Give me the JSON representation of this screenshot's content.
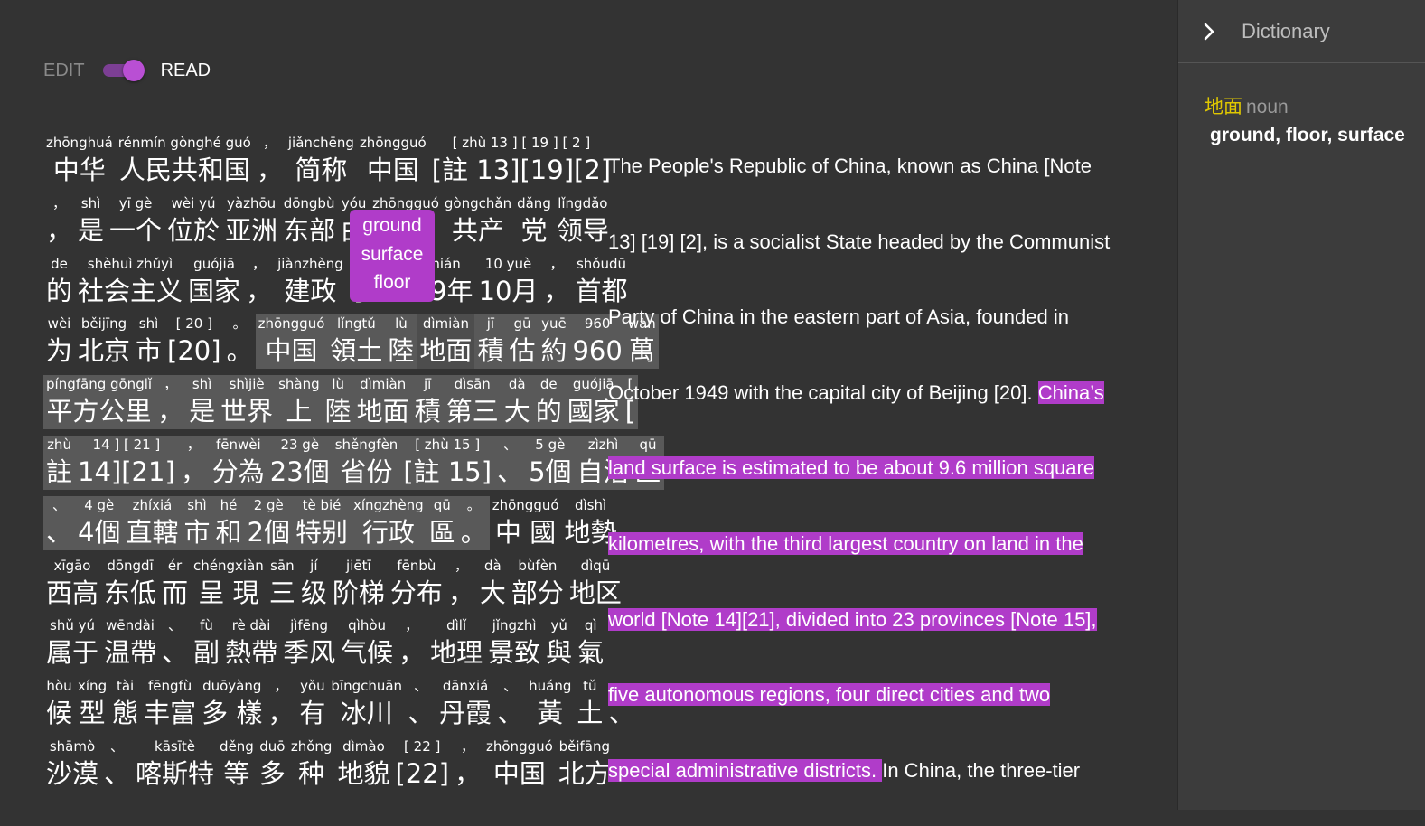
{
  "mode_toggle": {
    "edit_label": "EDIT",
    "read_label": "READ",
    "selected": "READ"
  },
  "chinese_lines": [
    [
      {
        "py": "zhōnghuá",
        "hz": "中华"
      },
      {
        "py": "rénmín gònghé guó",
        "hz": "人民共和国"
      },
      {
        "py": "，",
        "hz": "，"
      },
      {
        "py": "jiǎnchēng",
        "hz": "简称"
      },
      {
        "py": "zhōngguó",
        "hz": "中国"
      },
      {
        "py": "[ zhù 13 ] [ 19 ] [ 2 ]",
        "hz": "[註 13][19][2]"
      }
    ],
    [
      {
        "py": "，",
        "hz": "，"
      },
      {
        "py": "shì",
        "hz": "是"
      },
      {
        "py": "yī gè",
        "hz": "一个"
      },
      {
        "py": "wèi yú",
        "hz": "位於"
      },
      {
        "py": "yàzhōu",
        "hz": "亚洲"
      },
      {
        "py": "dōngbù",
        "hz": "东部"
      },
      {
        "py": "yóu",
        "hz": "由"
      },
      {
        "py": "zhōngguó",
        "hz": "中国"
      },
      {
        "py": "gòngchǎn",
        "hz": "共产"
      },
      {
        "py": "dǎng",
        "hz": "党"
      },
      {
        "py": "lǐngdǎo",
        "hz": "领导"
      }
    ],
    [
      {
        "py": "de",
        "hz": "的"
      },
      {
        "py": "shèhuì zhǔyì",
        "hz": "社会主义"
      },
      {
        "py": "guójiā",
        "hz": "国家"
      },
      {
        "py": "，",
        "hz": "，"
      },
      {
        "py": "jiànzhèng",
        "hz": "建政"
      },
      {
        "py": "yú",
        "hz": "于"
      },
      {
        "py": "1949 nián",
        "hz": "1949年"
      },
      {
        "py": "10 yuè",
        "hz": "10月"
      },
      {
        "py": "，",
        "hz": "，"
      },
      {
        "py": "shǒudū",
        "hz": "首都"
      }
    ],
    [
      {
        "py": "wèi",
        "hz": "为"
      },
      {
        "py": "běijīng",
        "hz": "北京"
      },
      {
        "py": "shì",
        "hz": "市"
      },
      {
        "py": "[ 20 ]",
        "hz": "[20]"
      },
      {
        "py": "。",
        "hz": "。"
      },
      {
        "py": "zhōngguó",
        "hz": "中国",
        "hl": true
      },
      {
        "py": "lǐngtǔ",
        "hz": "領土",
        "hl": true
      },
      {
        "py": "lù",
        "hz": "陸",
        "hl": true
      },
      {
        "py": "dìmiàn",
        "hz": "地面",
        "hl": true,
        "active": true
      },
      {
        "py": "jī",
        "hz": "積",
        "hl": true
      },
      {
        "py": "gū",
        "hz": "估",
        "hl": true
      },
      {
        "py": "yuē",
        "hz": "約",
        "hl": true
      },
      {
        "py": "960",
        "hz": "960",
        "hl": true
      },
      {
        "py": "wàn",
        "hz": "萬",
        "hl": true
      }
    ],
    [
      {
        "py": "píngfāng gōnglǐ",
        "hz": "平方公里",
        "hl": true
      },
      {
        "py": "，",
        "hz": "，",
        "hl": true
      },
      {
        "py": "shì",
        "hz": "是",
        "hl": true
      },
      {
        "py": "shìjiè",
        "hz": "世界",
        "hl": true
      },
      {
        "py": "shàng",
        "hz": "上",
        "hl": true
      },
      {
        "py": "lù",
        "hz": "陸",
        "hl": true
      },
      {
        "py": "dìmiàn",
        "hz": "地面",
        "hl": true
      },
      {
        "py": "jī",
        "hz": "積",
        "hl": true
      },
      {
        "py": "dìsān",
        "hz": "第三",
        "hl": true
      },
      {
        "py": "dà",
        "hz": "大",
        "hl": true
      },
      {
        "py": "de",
        "hz": "的",
        "hl": true
      },
      {
        "py": "guójiā",
        "hz": "國家",
        "hl": true
      },
      {
        "py": "[",
        "hz": "[",
        "hl": true
      }
    ],
    [
      {
        "py": "zhù",
        "hz": "註",
        "hl": true
      },
      {
        "py": "14 ] [ 21 ]",
        "hz": "14][21]",
        "hl": true
      },
      {
        "py": "，",
        "hz": "，",
        "hl": true
      },
      {
        "py": "fēnwèi",
        "hz": "分為",
        "hl": true
      },
      {
        "py": "23 gè",
        "hz": "23個",
        "hl": true
      },
      {
        "py": "shěngfèn",
        "hz": "省份",
        "hl": true
      },
      {
        "py": "[ zhù 15 ]",
        "hz": "[註 15]",
        "hl": true
      },
      {
        "py": "、",
        "hz": "、",
        "hl": true
      },
      {
        "py": "5 gè",
        "hz": "5個",
        "hl": true
      },
      {
        "py": "zìzhì",
        "hz": "自治",
        "hl": true
      },
      {
        "py": "qū",
        "hz": "區",
        "hl": true
      }
    ],
    [
      {
        "py": "、",
        "hz": "、",
        "hl": true
      },
      {
        "py": "4 gè",
        "hz": "4個",
        "hl": true
      },
      {
        "py": "zhíxiá",
        "hz": "直轄",
        "hl": true
      },
      {
        "py": "shì",
        "hz": "市",
        "hl": true
      },
      {
        "py": "hé",
        "hz": "和",
        "hl": true
      },
      {
        "py": "2 gè",
        "hz": "2個",
        "hl": true
      },
      {
        "py": "tè bié",
        "hz": "特别",
        "hl": true
      },
      {
        "py": "xíngzhèng",
        "hz": "行政",
        "hl": true
      },
      {
        "py": "qū",
        "hz": "區",
        "hl": true
      },
      {
        "py": "。",
        "hz": "。",
        "hl": true
      },
      {
        "py": "zhōngguó",
        "hz": "中 國"
      },
      {
        "py": "dìshì",
        "hz": "地勢"
      }
    ],
    [
      {
        "py": "xīgāo",
        "hz": "西高"
      },
      {
        "py": "dōngdī",
        "hz": "东低"
      },
      {
        "py": "ér",
        "hz": "而"
      },
      {
        "py": "chéngxiàn",
        "hz": "呈 現"
      },
      {
        "py": "sān",
        "hz": "三"
      },
      {
        "py": "jí",
        "hz": "级"
      },
      {
        "py": "jiētī",
        "hz": "阶梯"
      },
      {
        "py": "fēnbù",
        "hz": "分布"
      },
      {
        "py": "，",
        "hz": "，"
      },
      {
        "py": "dà",
        "hz": "大"
      },
      {
        "py": "bùfèn",
        "hz": "部分"
      },
      {
        "py": "dìqū",
        "hz": "地区"
      }
    ],
    [
      {
        "py": "shǔ yú",
        "hz": "属于"
      },
      {
        "py": "wēndài",
        "hz": "温帶"
      },
      {
        "py": "、",
        "hz": "、"
      },
      {
        "py": "fù",
        "hz": "副"
      },
      {
        "py": "rè dài",
        "hz": "熱帶"
      },
      {
        "py": "jìfēng",
        "hz": "季风"
      },
      {
        "py": "qìhòu",
        "hz": "气候"
      },
      {
        "py": "，",
        "hz": "，"
      },
      {
        "py": "dìlǐ",
        "hz": "地理"
      },
      {
        "py": "jǐngzhì",
        "hz": "景致"
      },
      {
        "py": "yǔ",
        "hz": "與"
      },
      {
        "py": "qì",
        "hz": "氣"
      }
    ],
    [
      {
        "py": "hòu",
        "hz": "候"
      },
      {
        "py": "xíng",
        "hz": "型"
      },
      {
        "py": "tài",
        "hz": "態"
      },
      {
        "py": "fēngfù",
        "hz": "丰富"
      },
      {
        "py": "duōyàng",
        "hz": "多 樣"
      },
      {
        "py": "，",
        "hz": "，"
      },
      {
        "py": "yǒu",
        "hz": "有"
      },
      {
        "py": "bīngchuān",
        "hz": "冰川"
      },
      {
        "py": "、",
        "hz": "、"
      },
      {
        "py": "dānxiá",
        "hz": "丹霞"
      },
      {
        "py": "、",
        "hz": "、"
      },
      {
        "py": "huáng",
        "hz": "黃"
      },
      {
        "py": "tǔ",
        "hz": "土"
      },
      {
        "py": "、",
        "hz": "、"
      }
    ],
    [
      {
        "py": "shāmò",
        "hz": "沙漠"
      },
      {
        "py": "、",
        "hz": "、"
      },
      {
        "py": "kāsītè",
        "hz": "喀斯特"
      },
      {
        "py": "děng",
        "hz": "等"
      },
      {
        "py": "duō",
        "hz": "多"
      },
      {
        "py": "zhǒng",
        "hz": "种"
      },
      {
        "py": "dìmào",
        "hz": "地貌"
      },
      {
        "py": "[ 22 ]",
        "hz": "[22]"
      },
      {
        "py": "，",
        "hz": "，"
      },
      {
        "py": "zhōngguó",
        "hz": "中国"
      },
      {
        "py": "běifāng",
        "hz": "北方"
      }
    ]
  ],
  "popup": {
    "lines": [
      "ground",
      "surface",
      "floor"
    ]
  },
  "english_lines": [
    [
      {
        "t": "The People's Republic of China, known as China [Note"
      }
    ],
    [
      {
        "t": "13] [19] [2], is a socialist State headed by the Communist"
      }
    ],
    [
      {
        "t": "Party of China in the eastern part of Asia, founded in"
      }
    ],
    [
      {
        "t": "October 1949 with the capital city of Beijing [20]. "
      },
      {
        "t": "China’s",
        "hl": true
      }
    ],
    [
      {
        "t": "land surface is estimated to be about 9.6 million square",
        "hl": true
      }
    ],
    [
      {
        "t": "kilometres, with the third largest country on land in the",
        "hl": true
      }
    ],
    [
      {
        "t": "world [Note 14][21], divided into 23 provinces [Note 15],",
        "hl": true
      }
    ],
    [
      {
        "t": "five autonomous regions, four direct cities and two",
        "hl": true
      }
    ],
    [
      {
        "t": "special administrative districts. ",
        "hl": true
      },
      {
        "t": "In China, the three-tier"
      }
    ]
  ],
  "dictionary": {
    "title": "Dictionary",
    "word": "地面",
    "part_of_speech": "noun",
    "definition": "ground, floor, surface"
  },
  "colors": {
    "background": "#333333",
    "sidebar": "#3c3c3c",
    "accent": "#b03cc9",
    "dict_word": "#e0c800"
  }
}
